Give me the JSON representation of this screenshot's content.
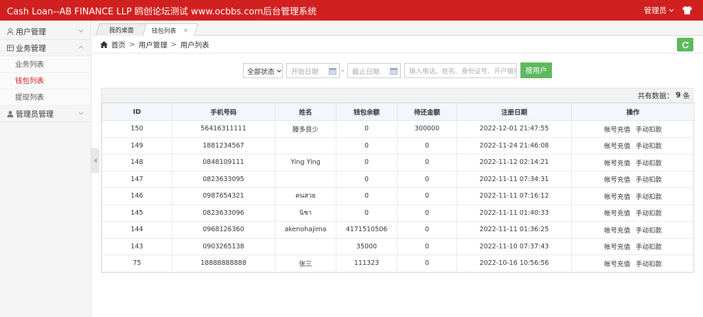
{
  "header": {
    "title": "Cash Loan--AB FINANCE LLP 鸥创论坛测试 www.ocbbs.com后台管理系统",
    "admin_label": "管理员"
  },
  "sidebar": {
    "groups": [
      {
        "label": "用户管理",
        "icon": "user-icon"
      },
      {
        "label": "业务管理",
        "icon": "grid-icon"
      },
      {
        "label": "管理员管理",
        "icon": "person-icon"
      }
    ],
    "items": [
      {
        "label": "业务列表"
      },
      {
        "label": "钱包列表"
      },
      {
        "label": "提现列表"
      }
    ]
  },
  "tabs": [
    {
      "label": "我的桌面"
    },
    {
      "label": "钱包列表",
      "close": "×"
    }
  ],
  "breadcrumb": {
    "home": "首页",
    "sep": ">",
    "level1": "用户管理",
    "level2": "用户列表"
  },
  "search": {
    "status_value": "全部状态",
    "start_placeholder": "开始日期",
    "dash": "-",
    "end_placeholder": "截止日期",
    "keyword_placeholder": "输入电话、姓名、身份证号、开户银行",
    "button_label": "搜用户"
  },
  "summary": {
    "prefix": "共有数据：",
    "count": "9",
    "unit": "条"
  },
  "table": {
    "columns": [
      "ID",
      "手机号码",
      "姓名",
      "钱包余额",
      "待还金额",
      "注册日期",
      "操作"
    ],
    "action_recharge": "帐号充值",
    "action_deduct": "手动扣款",
    "rows": [
      [
        "150",
        "56416311111",
        "滕多良少",
        "0",
        "300000",
        "2022-12-01 21:47:55"
      ],
      [
        "149",
        "1881234567",
        "",
        "0",
        "0",
        "2022-11-24 21:46:08"
      ],
      [
        "148",
        "0848109111",
        "Ying Ying",
        "0",
        "0",
        "2022-11-12 02:14:21"
      ],
      [
        "147",
        "0823633095",
        "",
        "0",
        "0",
        "2022-11-11 07:34:31"
      ],
      [
        "146",
        "0987654321",
        "คนสวย",
        "0",
        "0",
        "2022-11-11 07:16:12"
      ],
      [
        "145",
        "0823633096",
        "นิชา",
        "0",
        "0",
        "2022-11-11 01:40:33"
      ],
      [
        "144",
        "0968126360",
        "akenohajima",
        "4171510506",
        "0",
        "2022-11-11 01:36:25"
      ],
      [
        "143",
        "0903265138",
        "",
        "35000",
        "0",
        "2022-11-10 07:37:43"
      ],
      [
        "75",
        "18888888888",
        "张三",
        "111323",
        "0",
        "2022-10-16 10:56:56"
      ]
    ]
  },
  "colors": {
    "header_bg": "#d0201f",
    "active_menu": "#d0201f",
    "button_green": "#5eb95e"
  }
}
